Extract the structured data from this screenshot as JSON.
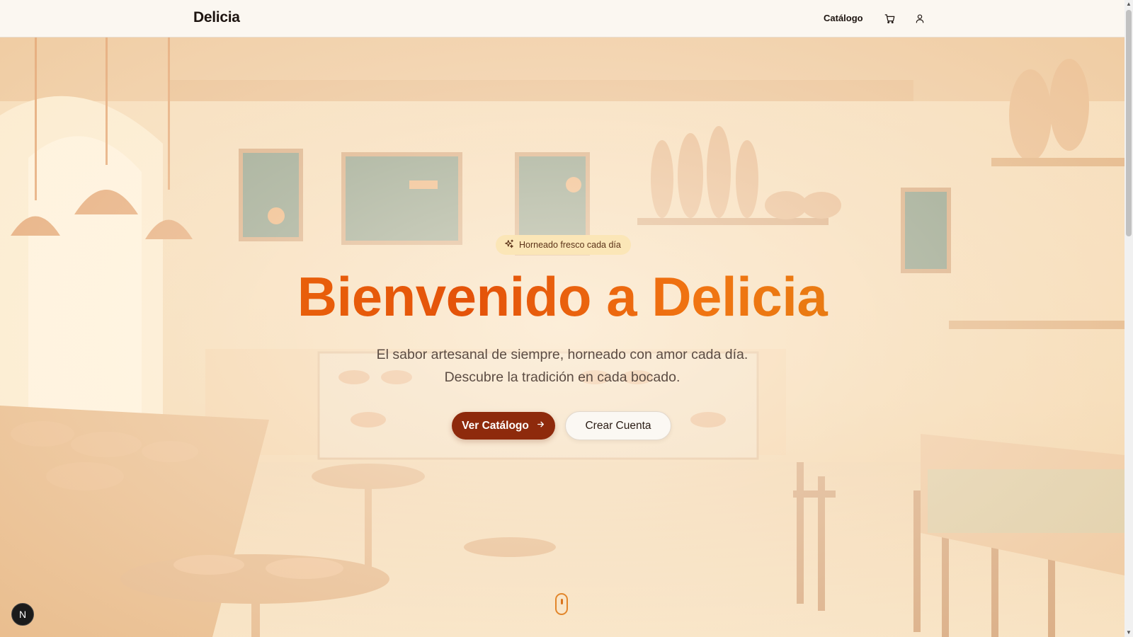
{
  "navbar": {
    "brand": "Delicia",
    "links": [
      {
        "label": "Catálogo"
      }
    ],
    "icons": [
      "cart-icon",
      "user-icon"
    ]
  },
  "hero": {
    "badge": "Horneado fresco cada día",
    "title": "Bienvenido a Delicia",
    "subtitle_lines": [
      "El sabor artesanal de siempre, horneado con amor cada día.",
      "Descubre la tradición en cada bocado."
    ],
    "primary_button": "Ver Catálogo",
    "secondary_button": "Crear Cuenta"
  },
  "dev_badge": "N",
  "colors": {
    "accent": "#e4530a",
    "primary_button_bg": "#8e2a0c",
    "badge_bg": "#fbe6b7",
    "brand_text": "#1d1410"
  }
}
